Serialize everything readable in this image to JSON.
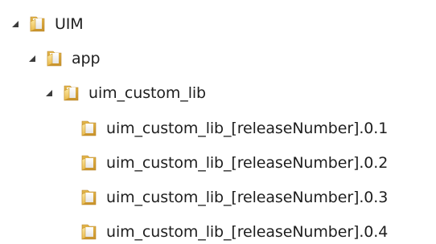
{
  "tree": {
    "root": {
      "label": "UIM",
      "icon": "folder-open-icon",
      "expanded": true,
      "children": {
        "app": {
          "label": "app",
          "icon": "folder-open-icon",
          "expanded": true,
          "children": {
            "lib": {
              "label": "uim_custom_lib",
              "icon": "folder-open-icon",
              "expanded": true,
              "children": [
                {
                  "label": "uim_custom_lib_[releaseNumber].0.1",
                  "icon": "folder-icon"
                },
                {
                  "label": "uim_custom_lib_[releaseNumber].0.2",
                  "icon": "folder-icon"
                },
                {
                  "label": "uim_custom_lib_[releaseNumber].0.3",
                  "icon": "folder-icon"
                },
                {
                  "label": "uim_custom_lib_[releaseNumber].0.4",
                  "icon": "folder-icon"
                }
              ]
            }
          }
        }
      }
    }
  },
  "colors": {
    "text": "#1e1e1e",
    "expander": "#3c3c3c",
    "folder_back": "#d9a62c",
    "folder_front": "#f6d36b",
    "folder_highlight": "#fdeea8"
  }
}
